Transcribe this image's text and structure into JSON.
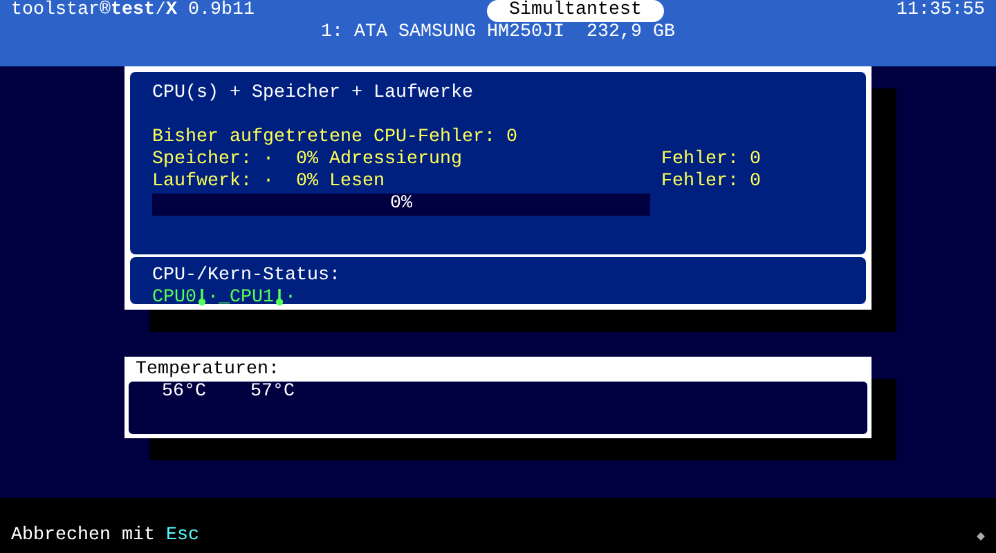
{
  "header": {
    "app": "toolstar®**test∕X** 0.9b11",
    "mode": "Simultantest",
    "time": "11:35:55",
    "drive": "1: ATA SAMSUNG HM250JI  232,9 GB"
  },
  "test_panel": {
    "title": "CPU(s) + Speicher + Laufwerke",
    "cpu_errors": "Bisher aufgetretene CPU-Fehler: 0",
    "rows": [
      {
        "label": "Speicher: ·  0% Adressierung",
        "errors": "Fehler: 0"
      },
      {
        "label": "Laufwerk: ·  0% Lesen",
        "errors": "Fehler: 0"
      }
    ],
    "progress": {
      "level": 0,
      "reading": "0%"
    },
    "core_status_title": "CPU-/Kern-Status:",
    "cores": [
      {
        "label": "CPU0",
        "dot": "·"
      },
      {
        "label": "_CPU1",
        "dot": "·"
      }
    ]
  },
  "temperatures": {
    "title": "Temperaturen:",
    "values": [
      "56°C",
      "57°C"
    ]
  },
  "footer": {
    "hint": "Abbrechen mit",
    "key": "Esc"
  }
}
